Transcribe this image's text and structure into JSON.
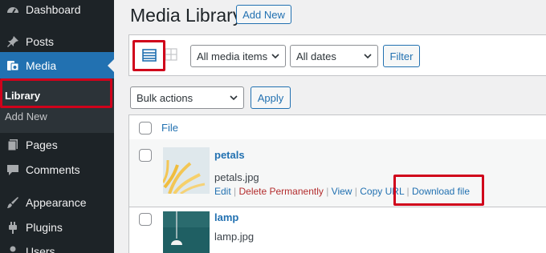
{
  "sidebar": {
    "items": [
      {
        "label": "Dashboard",
        "icon": "dashboard-icon"
      },
      {
        "label": "Posts",
        "icon": "pushpin-icon"
      },
      {
        "label": "Media",
        "icon": "media-icon",
        "active": true
      },
      {
        "label": "Pages",
        "icon": "pages-icon"
      },
      {
        "label": "Comments",
        "icon": "comment-icon"
      },
      {
        "label": "Appearance",
        "icon": "paintbrush-icon"
      },
      {
        "label": "Plugins",
        "icon": "plugin-icon"
      },
      {
        "label": "Users",
        "icon": "users-icon"
      }
    ],
    "submenu": {
      "library": "Library",
      "add_new": "Add New"
    }
  },
  "header": {
    "title": "Media Library",
    "add_new": "Add New"
  },
  "toolbar": {
    "type_filter": "All media items",
    "date_filter": "All dates",
    "filter_button": "Filter",
    "bulk_actions": "Bulk actions",
    "apply_button": "Apply"
  },
  "table": {
    "column_file": "File",
    "rows": [
      {
        "title": "petals",
        "filename": "petals.jpg",
        "actions": {
          "edit": "Edit",
          "delete": "Delete Permanently",
          "view": "View",
          "copy": "Copy URL",
          "download": "Download file"
        }
      },
      {
        "title": "lamp",
        "filename": "lamp.jpg"
      }
    ]
  },
  "colors": {
    "accent": "#2271b1",
    "highlight": "#d0021b",
    "sidebar": "#1d2327",
    "delete": "#b32d2e"
  }
}
